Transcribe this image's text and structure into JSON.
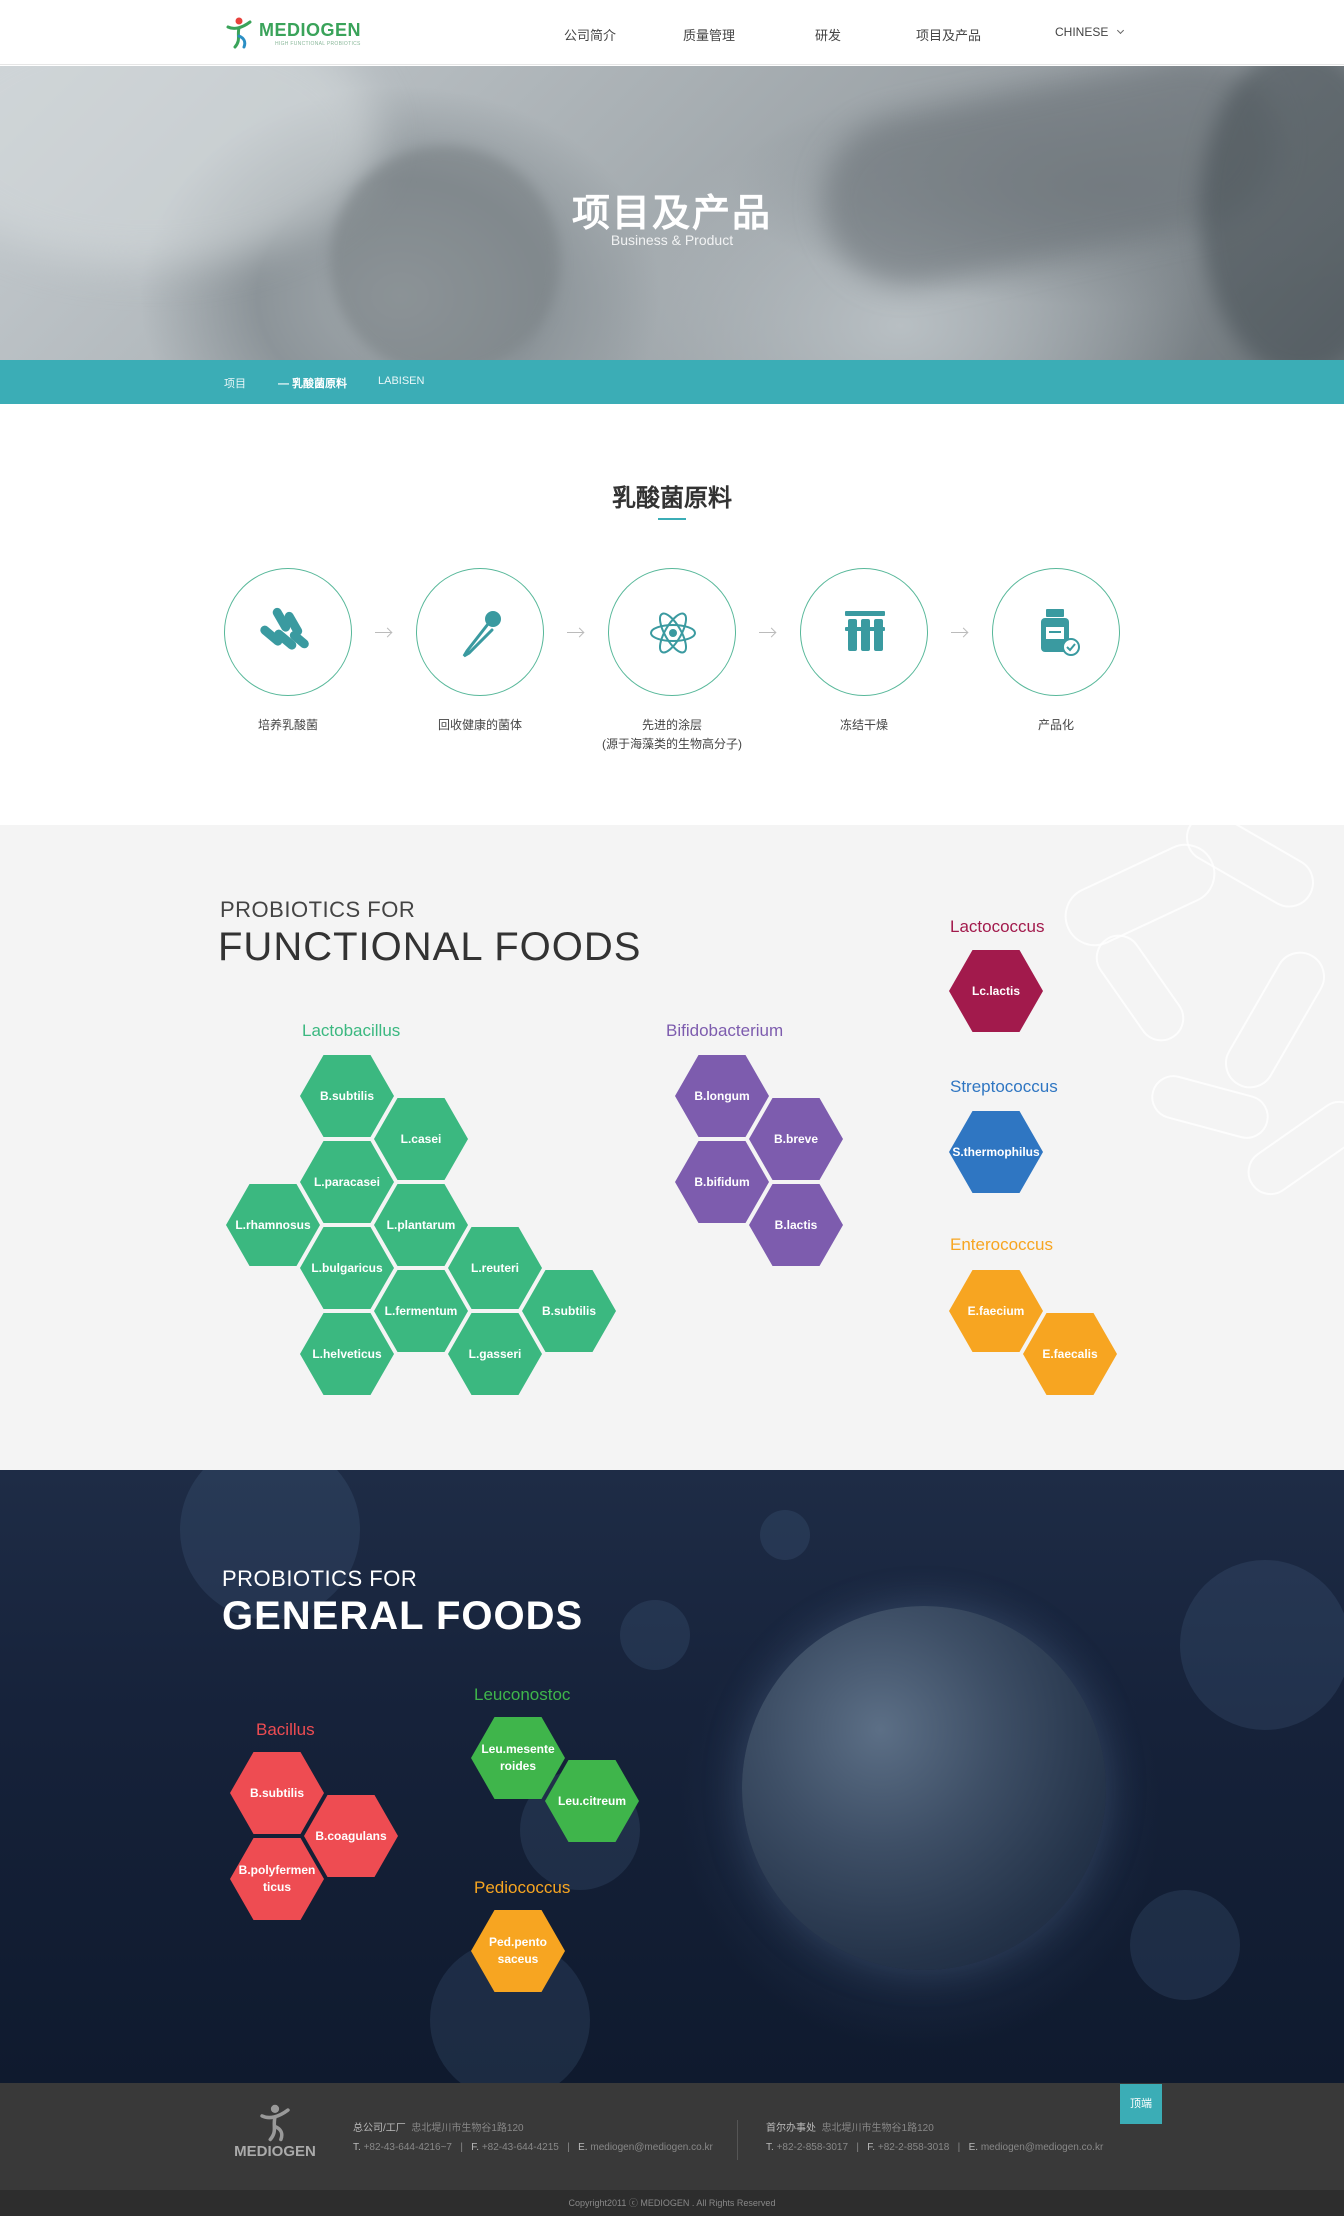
{
  "header": {
    "logo_text": "MEDIOGEN",
    "logo_sub": "HIGH FUNCTIONAL PROBIOTICS",
    "nav": [
      "公司简介",
      "质量管理",
      "研发",
      "项目及产品"
    ],
    "lang": "CHINESE"
  },
  "hero": {
    "title": "项目及产品",
    "subtitle": "Business & Product"
  },
  "breadcrumb": [
    "项目",
    "— 乳酸菌原料",
    "LABISEN"
  ],
  "process": {
    "title": "乳酸菌原料",
    "steps": [
      {
        "label": "培养乳酸菌",
        "icon": "bacteria-icon"
      },
      {
        "label": "回收健康的菌体",
        "icon": "dropper-icon"
      },
      {
        "label": "先进的涂层\n(源于海藻类的生物高分子)",
        "icon": "atom-icon"
      },
      {
        "label": "冻结干燥",
        "icon": "test-tubes-icon"
      },
      {
        "label": "产品化",
        "icon": "product-jar-icon"
      }
    ]
  },
  "functional": {
    "small": "PROBIOTICS FOR",
    "big": "FUNCTIONAL FOODS",
    "lactobacillus": {
      "name": "Lactobacillus",
      "color": "#3bb880",
      "items": [
        "B.subtilis",
        "L.casei",
        "L.paracasei",
        "L.rhamnosus",
        "L.plantarum",
        "L.bulgaricus",
        "L.reuteri",
        "B.subtilis",
        "L.fermentum",
        "L.helveticus",
        "L.gasseri"
      ]
    },
    "bifidobacterium": {
      "name": "Bifidobacterium",
      "color": "#7d5cae",
      "items": [
        "B.longum",
        "B.breve",
        "B.bifidum",
        "B.lactis"
      ]
    },
    "lactococcus": {
      "name": "Lactococcus",
      "color": "#a21a4c",
      "items": [
        "Lc.lactis"
      ]
    },
    "streptococcus": {
      "name": "Streptococcus",
      "color": "#2f76c2",
      "items": [
        "S.thermophilus"
      ]
    },
    "enterococcus": {
      "name": "Enterococcus",
      "color": "#f7a521",
      "items": [
        "E.faecium",
        "E.faecalis"
      ]
    }
  },
  "general": {
    "small": "PROBIOTICS FOR",
    "big": "GENERAL FOODS",
    "bacillus": {
      "name": "Bacillus",
      "color": "#ee4c52",
      "items": [
        "B.subtilis",
        "B.coagulans",
        "B.polyfermen\nticus"
      ]
    },
    "leuconostoc": {
      "name": "Leuconostoc",
      "color": "#3fb54b",
      "items": [
        "Leu.mesente\nroides",
        "Leu.citreum"
      ]
    },
    "pediococcus": {
      "name": "Pediococcus",
      "color": "#f7a521",
      "items": [
        "Ped.pento\nsaceus"
      ]
    }
  },
  "footer": {
    "logo_text": "MEDIOGEN",
    "hq_label": "总公司/工厂",
    "hq_addr": "忠北堤川市生物谷1路120",
    "hq_tel": "+82-43-644-4216~7",
    "hq_fax": "+82-43-644-4215",
    "hq_email": "mediogen@mediogen.co.kr",
    "seoul_label": "首尔办事处",
    "seoul_addr": "忠北堤川市生物谷1路120",
    "seoul_tel": "+82-2-858-3017",
    "seoul_fax": "+82-2-858-3018",
    "seoul_email": "mediogen@mediogen.co.kr",
    "top_button": "顶端",
    "copyright": "Copyright2011 ⓒ MEDIOGEN . All Rights Reserved"
  }
}
